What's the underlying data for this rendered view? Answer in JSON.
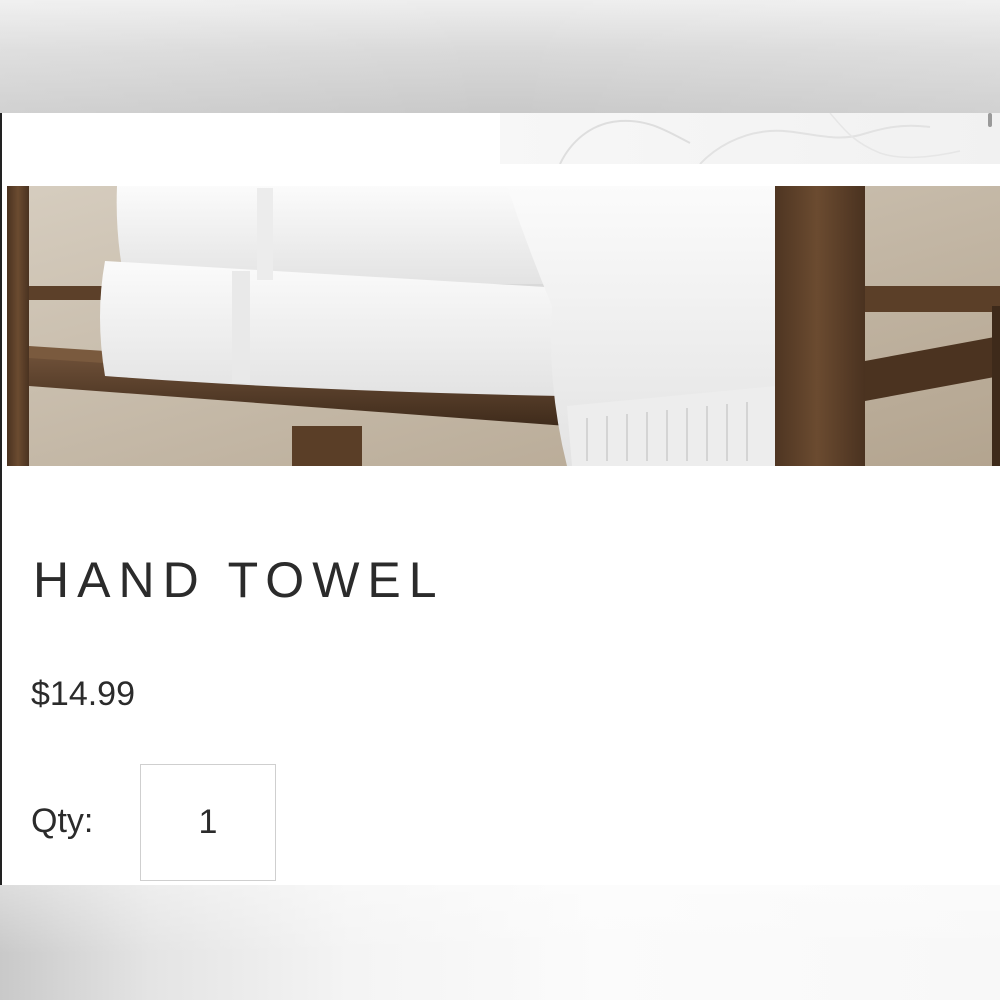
{
  "product": {
    "title": "HAND TOWEL",
    "price": "$14.99",
    "image_alt_icon": "towel-photo"
  },
  "quantity": {
    "label": "Qty:",
    "value": "1"
  },
  "colors": {
    "text": "#2b2b2b",
    "input_border": "#cfcfcf",
    "wood": "#5e4128"
  }
}
